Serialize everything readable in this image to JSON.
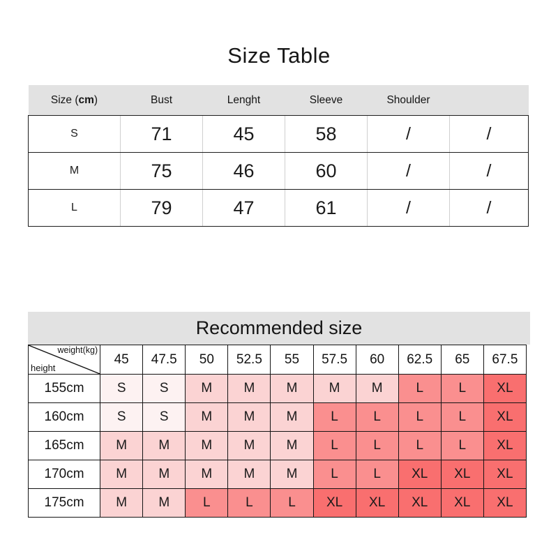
{
  "size_table": {
    "title": "Size Table",
    "unit_label_prefix": "Size (",
    "unit_label_bold": "cm",
    "unit_label_suffix": ")",
    "headers": [
      "Size (cm)",
      "Bust",
      "Lenght",
      "Sleeve",
      "Shoulder",
      ""
    ],
    "rows": [
      {
        "size": "S",
        "bust": "71",
        "lenght": "45",
        "sleeve": "58",
        "shoulder": "/",
        "extra": "/"
      },
      {
        "size": "M",
        "bust": "75",
        "lenght": "46",
        "sleeve": "60",
        "shoulder": "/",
        "extra": "/"
      },
      {
        "size": "L",
        "bust": "79",
        "lenght": "47",
        "sleeve": "61",
        "shoulder": "/",
        "extra": "/"
      }
    ]
  },
  "recommended": {
    "banner_title": "Recommended size",
    "corner": {
      "weight_label": "weight(kg)",
      "height_label": "height"
    },
    "weights": [
      "45",
      "47.5",
      "50",
      "52.5",
      "55",
      "57.5",
      "60",
      "62.5",
      "65",
      "67.5"
    ],
    "heights": [
      "155cm",
      "160cm",
      "165cm",
      "170cm",
      "175cm"
    ],
    "grid": [
      [
        "S",
        "S",
        "M",
        "M",
        "M",
        "M",
        "M",
        "L",
        "L",
        "XL"
      ],
      [
        "S",
        "S",
        "M",
        "M",
        "M",
        "L",
        "L",
        "L",
        "L",
        "XL"
      ],
      [
        "M",
        "M",
        "M",
        "M",
        "M",
        "L",
        "L",
        "L",
        "L",
        "XL"
      ],
      [
        "M",
        "M",
        "M",
        "M",
        "M",
        "L",
        "L",
        "XL",
        "XL",
        "XL"
      ],
      [
        "M",
        "M",
        "L",
        "L",
        "L",
        "XL",
        "XL",
        "XL",
        "XL",
        "XL"
      ]
    ],
    "legend_colors": {
      "S": "#fdf2f2",
      "M": "#fbd3d3",
      "L": "#fa8f8f",
      "XL": "#f96f6f"
    }
  }
}
